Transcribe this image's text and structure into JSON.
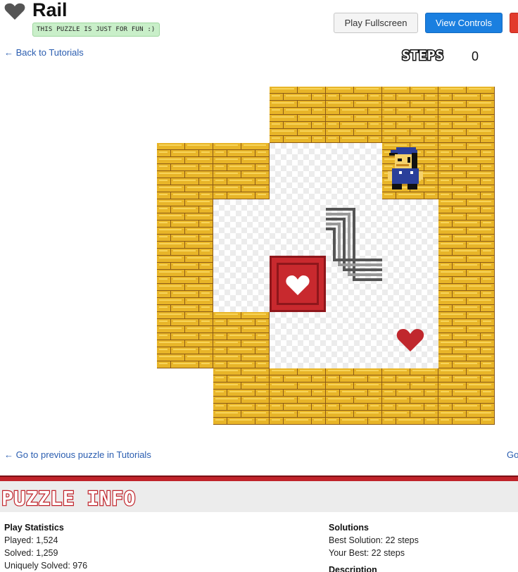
{
  "header": {
    "title": "Rail",
    "title_icon": "heart-icon",
    "badge": "THIS PUZZLE IS JUST FOR FUN :)"
  },
  "toolbar": {
    "play_fullscreen": "Play Fullscreen",
    "view_controls": "View Controls"
  },
  "nav": {
    "back": "← Back to Tutorials",
    "previous": "← Go to previous puzzle in Tutorials",
    "next": "Go"
  },
  "steps": {
    "label": "STEPS",
    "value": "0"
  },
  "board": {
    "grid_cols": 6,
    "grid_rows": 6,
    "rows": [
      "WWWWWW",
      "##.PWW",
      "#....#",
      "#.B..#",
      "##...#",
      "WWWWWW"
    ],
    "player": {
      "col": 4,
      "row": 1
    },
    "crate": {
      "col": 2,
      "row": 3
    },
    "goal": {
      "col": 4,
      "row": 4
    },
    "rail_icon": "rail-icon",
    "colors": {
      "brick": "#e8b528",
      "mortar": "#8c5a16",
      "brick_light": "#f7d45a",
      "floor_a": "#ffffff",
      "floor_b": "#ececec",
      "crate": "#c8292e",
      "crate_dark": "#8e161b",
      "goal": "#c0272d",
      "player_cap": "#2a3f9a"
    }
  },
  "info": {
    "title": "PUZZLE INFO",
    "play_stats": {
      "heading": "Play Statistics",
      "played": "Played: 1,524",
      "solved": "Solved: 1,259",
      "uniquely": "Uniquely Solved: 976"
    },
    "solutions": {
      "heading": "Solutions",
      "best": "Best Solution: 22 steps",
      "yours": "Your Best: 22 steps",
      "cut": "Description"
    }
  }
}
